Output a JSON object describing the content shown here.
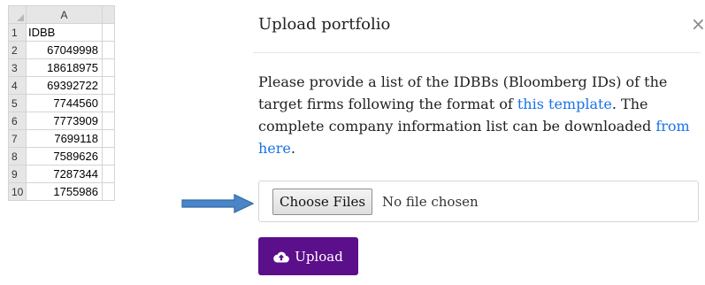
{
  "spreadsheet": {
    "column_header": "A",
    "rows": [
      {
        "num": "1",
        "value": "IDBB"
      },
      {
        "num": "2",
        "value": "67049998"
      },
      {
        "num": "3",
        "value": "18618975"
      },
      {
        "num": "4",
        "value": "69392722"
      },
      {
        "num": "5",
        "value": "7744560"
      },
      {
        "num": "6",
        "value": "7773909"
      },
      {
        "num": "7",
        "value": "7699118"
      },
      {
        "num": "8",
        "value": "7589626"
      },
      {
        "num": "9",
        "value": "7287344"
      },
      {
        "num": "10",
        "value": "1755986"
      }
    ]
  },
  "arrow": {
    "icon": "right-arrow-icon",
    "color": "#4a86c7"
  },
  "dialog": {
    "title": "Upload portfolio",
    "close_symbol": "×",
    "description": {
      "part1": "Please provide a list of the IDBBs (Bloomberg IDs) of the target firms following the format of ",
      "link1": "this template",
      "part2": ". The complete company information list can be downloaded ",
      "link2": "from here",
      "part3": "."
    },
    "file_input": {
      "button_label": "Choose Files",
      "status": "No file chosen"
    },
    "upload_button": {
      "label": "Upload",
      "icon": "cloud-upload-icon",
      "color": "#5b0f8b"
    },
    "link_color": "#1a73e8"
  }
}
